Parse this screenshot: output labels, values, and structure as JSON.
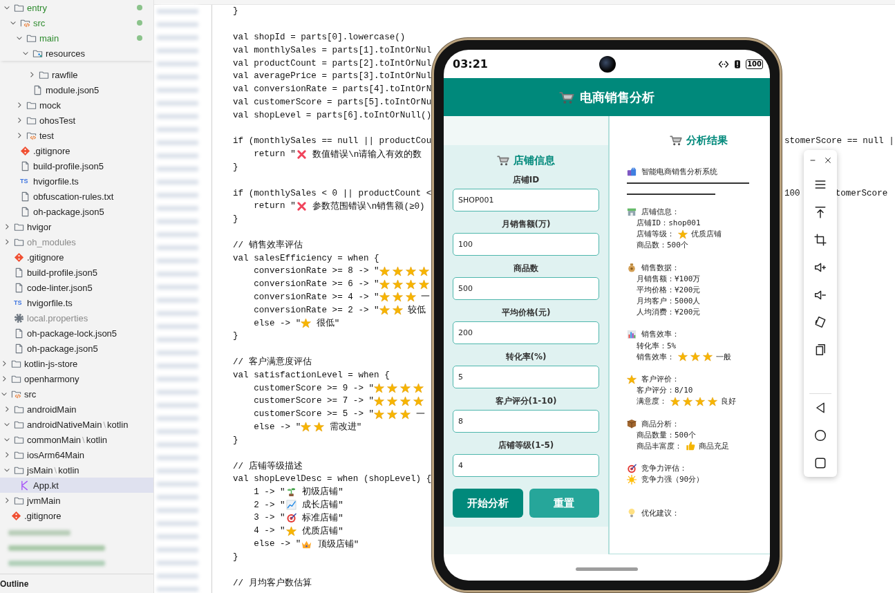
{
  "sidebar": {
    "upper_items": [
      {
        "label": "entry",
        "kind": "folder",
        "expanded": true,
        "modified": true,
        "selected": false,
        "children": [
          {
            "label": "src",
            "kind": "srcfolder",
            "expanded": true,
            "modified": true,
            "selected": false,
            "children": [
              {
                "label": "main",
                "kind": "folder",
                "expanded": true,
                "modified": true,
                "selected": false,
                "children": [
                  {
                    "label": "resources",
                    "kind": "resfolder",
                    "expanded": true,
                    "pinned": true,
                    "selected": false,
                    "children": [
                      {
                        "label": "rawfile",
                        "kind": "folder",
                        "expanded": false,
                        "selected": false
                      }
                    ]
                  },
                  {
                    "label": "module.json5",
                    "kind": "file",
                    "selected": false
                  }
                ]
              },
              {
                "label": "mock",
                "kind": "folder",
                "expanded": false,
                "selected": false
              },
              {
                "label": "ohosTest",
                "kind": "folder",
                "expanded": false,
                "selected": false
              },
              {
                "label": "test",
                "kind": "srcfolder",
                "expanded": false,
                "selected": false
              }
            ]
          },
          {
            "label": ".gitignore",
            "kind": "git",
            "selected": false
          },
          {
            "label": "build-profile.json5",
            "kind": "file",
            "selected": false
          },
          {
            "label": "hvigorfile.ts",
            "kind": "ts",
            "badge": "TS",
            "selected": false
          },
          {
            "label": "obfuscation-rules.txt",
            "kind": "file",
            "selected": false
          },
          {
            "label": "oh-package.json5",
            "kind": "file",
            "selected": false
          }
        ]
      },
      {
        "label": "hvigor",
        "kind": "folder",
        "expanded": false,
        "selected": false
      },
      {
        "label": "oh_modules",
        "kind": "folder",
        "expanded": false,
        "dimmed": true,
        "selected": false
      },
      {
        "label": ".gitignore",
        "kind": "git",
        "selected": false
      },
      {
        "label": "build-profile.json5",
        "kind": "file",
        "selected": false
      },
      {
        "label": "code-linter.json5",
        "kind": "file",
        "selected": false
      },
      {
        "label": "hvigorfile.ts",
        "kind": "ts",
        "badge": "TS",
        "selected": false
      },
      {
        "label": "local.properties",
        "kind": "gear",
        "dimmed": true,
        "selected": false
      },
      {
        "label": "oh-package-lock.json5",
        "kind": "file",
        "selected": false
      },
      {
        "label": "oh-package.json5",
        "kind": "file",
        "selected": false
      }
    ],
    "items": [
      {
        "label": "kotlin-js-store",
        "kind": "folder",
        "expanded": false,
        "selected": false
      },
      {
        "label": "openharmony",
        "kind": "folder",
        "expanded": false,
        "selected": false
      },
      {
        "label": "src",
        "kind": "srcfolder",
        "expanded": true,
        "selected": false,
        "children": [
          {
            "label": "androidMain",
            "kind": "folder",
            "expanded": false,
            "selected": false
          },
          {
            "label": "androidNativeMain",
            "separator": "\\",
            "sub": "kotlin",
            "kind": "folder",
            "expanded": true,
            "selected": false
          },
          {
            "label": "commonMain",
            "separator": "\\",
            "sub": "kotlin",
            "kind": "folder",
            "expanded": true,
            "selected": false
          },
          {
            "label": "iosArm64Main",
            "kind": "folder",
            "expanded": false,
            "selected": false
          },
          {
            "label": "jsMain",
            "separator": "\\",
            "sub": "kotlin",
            "kind": "folder",
            "expanded": true,
            "selected": false,
            "children": [
              {
                "label": "App.kt",
                "kind": "kotlin",
                "selected": true
              }
            ]
          },
          {
            "label": "jvmMain",
            "kind": "folder",
            "expanded": false,
            "selected": false
          }
        ]
      },
      {
        "label": ".gitignore",
        "kind": "git",
        "selected": false
      }
    ],
    "footer": "Outline"
  },
  "editor": {
    "lines": [
      {
        "kind": "code",
        "text": "}"
      },
      {
        "kind": "blank"
      },
      {
        "kind": "code",
        "text": "val shopId = parts[0].lowercase()"
      },
      {
        "kind": "code",
        "text": "val monthlySales = parts[1].toIntOrNul"
      },
      {
        "kind": "code",
        "text": "val productCount = parts[2].toIntOrNul"
      },
      {
        "kind": "code",
        "text": "val averagePrice = parts[3].toIntOrNul"
      },
      {
        "kind": "code",
        "text": "val conversionRate = parts[4].toIntOrN"
      },
      {
        "kind": "code",
        "text": "val customerScore = parts[5].toIntOrNu"
      },
      {
        "kind": "code",
        "text": "val shopLevel = parts[6].toIntOrNull()"
      },
      {
        "kind": "blank"
      },
      {
        "kind": "code",
        "text": "if (monthlySales == null || productCou",
        "tails": [
          "stomerScore == null |"
        ]
      },
      {
        "kind": "code",
        "text": "    return \"",
        "rest": " 数值错误\\n请输入有效的数"
      },
      {
        "kind": "code",
        "text": "}"
      },
      {
        "kind": "blank"
      },
      {
        "kind": "code",
        "text": "if (monthlySales < 0 || productCount <",
        "tails": [
          "100",
          "tomerScore"
        ]
      },
      {
        "kind": "code",
        "text": "    return \"",
        "rest": " 参数范围错误\\n销售额(≥0)"
      },
      {
        "kind": "code",
        "text": "}"
      },
      {
        "kind": "blank"
      },
      {
        "kind": "code",
        "text": "// 销售效率评估"
      },
      {
        "kind": "code",
        "text": "val salesEfficiency = when {"
      },
      {
        "kind": "code",
        "text": "    conversionRate >= 8 -> \""
      },
      {
        "kind": "code",
        "text": "    conversionRate >= 6 -> \""
      },
      {
        "kind": "code",
        "text": "    conversionRate >= 4 -> \"",
        "rest": " 一"
      },
      {
        "kind": "code",
        "text": "    conversionRate >= 2 -> \"",
        "rest": " 较低"
      },
      {
        "kind": "code",
        "text": "    else -> \"",
        "rest": " 很低\""
      },
      {
        "kind": "code",
        "text": "}"
      },
      {
        "kind": "blank"
      },
      {
        "kind": "code",
        "text": "// 客户满意度评估"
      },
      {
        "kind": "code",
        "text": "val satisfactionLevel = when {"
      },
      {
        "kind": "code",
        "text": "    customerScore >= 9 -> \""
      },
      {
        "kind": "code",
        "text": "    customerScore >= 7 -> \""
      },
      {
        "kind": "code",
        "text": "    customerScore >= 5 -> \"",
        "rest": " 一"
      },
      {
        "kind": "code",
        "text": "    else -> \"",
        "rest": " 需改进\""
      },
      {
        "kind": "code",
        "text": "}"
      },
      {
        "kind": "blank"
      },
      {
        "kind": "code",
        "text": "// 店铺等级描述"
      },
      {
        "kind": "code",
        "text": "val shopLevelDesc = when (shopLevel) {"
      },
      {
        "kind": "code",
        "text": "    1 -> \"",
        "rest": " 初级店铺\""
      },
      {
        "kind": "code",
        "text": "    2 -> \"",
        "rest": " 成长店铺\""
      },
      {
        "kind": "code",
        "text": "    3 -> \"",
        "rest": " 标准店铺\""
      },
      {
        "kind": "code",
        "text": "    4 -> \"",
        "rest": " 优质店铺\""
      },
      {
        "kind": "code",
        "text": "    else -> \"",
        "rest": " 顶级店铺\""
      },
      {
        "kind": "code",
        "text": "}"
      },
      {
        "kind": "blank"
      },
      {
        "kind": "code",
        "text": "// 月均客户数估算"
      }
    ]
  },
  "device": {
    "time": "03:21",
    "battery": "100",
    "header": "电商销售分析",
    "form": {
      "title": "店铺信息",
      "fields": [
        {
          "label": "店铺ID",
          "value": "SHOP001"
        },
        {
          "label": "月销售额(万)",
          "value": "100"
        },
        {
          "label": "商品数",
          "value": "500"
        },
        {
          "label": "平均价格(元)",
          "value": "200"
        },
        {
          "label": "转化率(%)",
          "value": "5"
        },
        {
          "label": "客户评分(1-10)",
          "value": "8"
        },
        {
          "label": "店铺等级(1-5)",
          "value": "4"
        }
      ],
      "buttons": [
        {
          "label": "开始分析",
          "kind": "primary"
        },
        {
          "label": "重置",
          "kind": "secondary"
        }
      ]
    },
    "results": {
      "title": "分析结果",
      "intro": "智能电商销售分析系统",
      "sections": [
        {
          "heading": "店铺信息：",
          "lines": [
            {
              "text": "店铺ID：shop001"
            },
            {
              "text": "店铺等级：",
              "rest": "优质店铺"
            },
            {
              "text": "商品数：500个"
            }
          ]
        },
        {
          "heading": "销售数据：",
          "lines": [
            {
              "text": "月销售额：¥100万"
            },
            {
              "text": "平均价格：¥200元"
            },
            {
              "text": "月均客户：5000人"
            },
            {
              "text": "人均消费：¥200元"
            }
          ]
        },
        {
          "heading": "销售效率：",
          "lines": [
            {
              "text": "转化率：5%"
            },
            {
              "text": "销售效率：",
              "stars": 3,
              "rest": "一般"
            }
          ]
        },
        {
          "heading": "客户评价：",
          "lines": [
            {
              "text": "客户评分：8/10"
            },
            {
              "text": "满意度：",
              "stars": 4,
              "rest": "良好"
            }
          ]
        },
        {
          "heading": "商品分析：",
          "lines": [
            {
              "text": "商品数量：500个"
            },
            {
              "text": "商品丰富度：",
              "rest": "商品充足"
            }
          ]
        },
        {
          "heading": "竞争力评估：",
          "lines": [
            {
              "text": "竞争力强（90分）"
            }
          ]
        },
        {
          "heading": "优化建议："
        }
      ]
    }
  }
}
